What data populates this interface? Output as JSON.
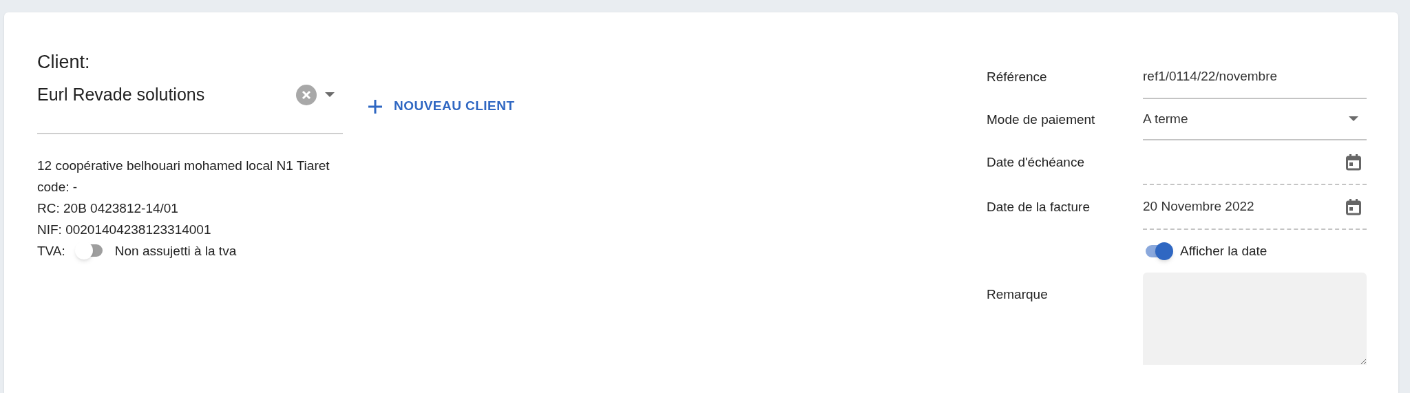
{
  "client": {
    "label": "Client:",
    "value": "Eurl Revade solutions",
    "new_button": "NOUVEAU CLIENT"
  },
  "client_details": [
    "12 coopérative belhouari mohamed local N1 Tiaret",
    "code: -",
    "RC: 20B 0423812-14/01",
    "NIF: 00201404238123314001"
  ],
  "tva": {
    "label": "TVA:",
    "on": false,
    "text": "Non assujetti à la tva"
  },
  "form": [
    {
      "kind": "text",
      "label": "Référence",
      "value": "ref1/0114/22/novembre"
    },
    {
      "kind": "select",
      "label": "Mode de paiement",
      "value": "A terme"
    },
    {
      "kind": "date",
      "label": "Date d'échéance"
    },
    {
      "kind": "date",
      "label": "Date de la facture",
      "value": "20 Novembre 2022"
    },
    {
      "kind": "toggle",
      "label": "Afficher la date",
      "on": true
    },
    {
      "kind": "textarea",
      "label": "Remarque"
    }
  ]
}
